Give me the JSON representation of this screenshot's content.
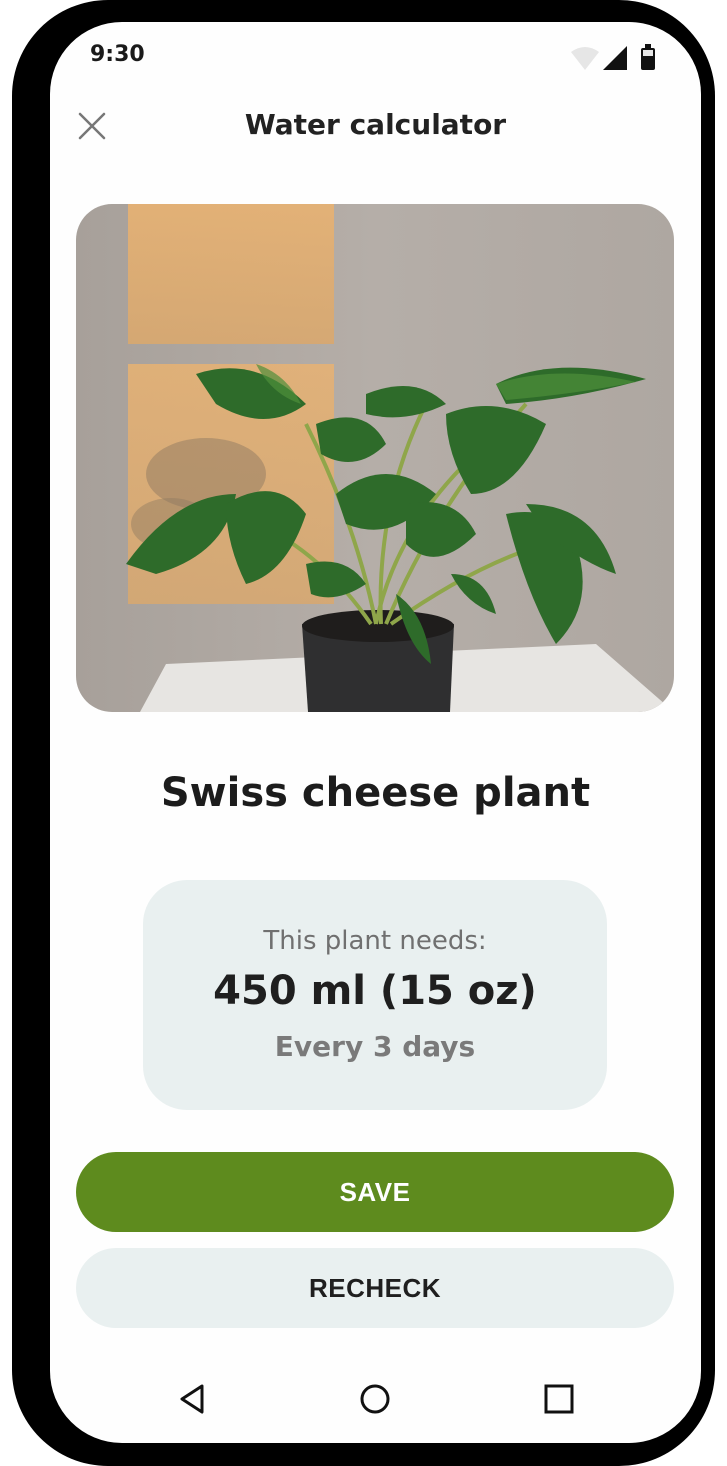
{
  "status_bar": {
    "time": "9:30",
    "icons": [
      "wifi-icon",
      "cellular-signal-icon",
      "battery-icon"
    ]
  },
  "header": {
    "title": "Water calculator",
    "close_icon": "close-icon"
  },
  "plant": {
    "name": "Swiss cheese plant",
    "photo_subject": "plant-photo"
  },
  "needs_card": {
    "label": "This plant needs:",
    "amount": "450 ml (15 oz)",
    "frequency": "Every 3 days"
  },
  "actions": {
    "save_label": "SAVE",
    "recheck_label": "RECHECK"
  },
  "nav_bar": {
    "items": [
      "back-icon",
      "home-icon",
      "recents-icon"
    ]
  },
  "colors": {
    "accent": "#5e8b1e",
    "card_background": "#e9f0f0",
    "text_primary": "#1f1f1f",
    "text_secondary": "#707070"
  }
}
